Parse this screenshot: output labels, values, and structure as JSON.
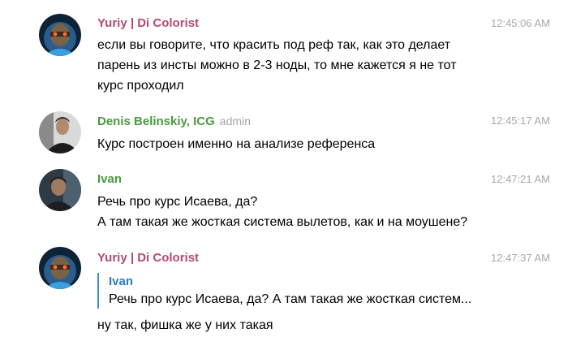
{
  "messages": [
    {
      "author": "Yuriy | Di Colorist",
      "author_color": "#b54974",
      "time": "12:45:06 AM",
      "text": "если вы говорите, что красить под реф так, как это делает\nпарень из инсты можно в 2-3 ноды, то мне кажется я не тот\nкурс проходил"
    },
    {
      "author": "Denis Belinskiy, ICG",
      "role": "admin",
      "author_color": "#4a9a3f",
      "time": "12:45:17 AM",
      "text": "Курс построен именно на анализе референса"
    },
    {
      "author": "Ivan",
      "author_color": "#4a9a3f",
      "time": "12:47:21 AM",
      "text": "Речь про курс Исаева, да?\nА там такая же жосткая система вылетов, как и на моушене?"
    },
    {
      "author": "Yuriy | Di Colorist",
      "author_color": "#b54974",
      "time": "12:47:37 AM",
      "reply": {
        "author": "Ivan",
        "text": "Речь про курс Исаева, да? А там такая же жосткая систем..."
      },
      "text": "ну так, фишка же у них такая"
    }
  ]
}
